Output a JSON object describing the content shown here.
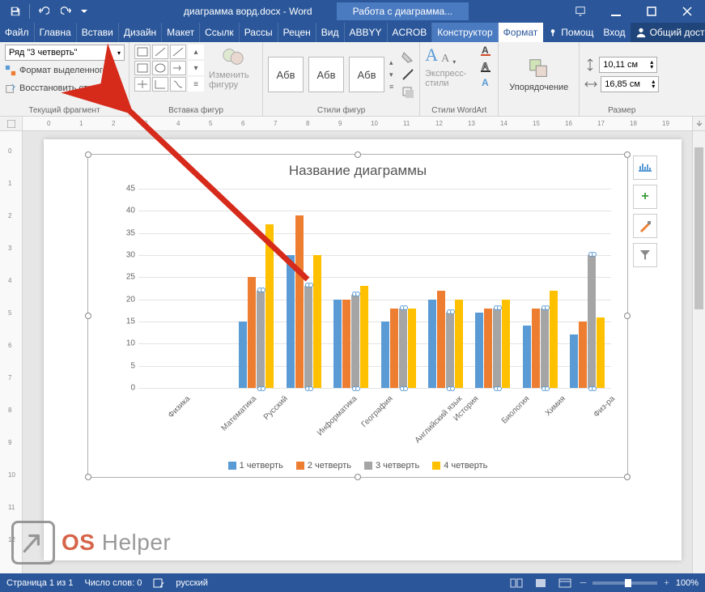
{
  "app": {
    "title_doc": "диаграмма ворд.docx - Word",
    "context_title": "Работа с диаграмма..."
  },
  "tabs": {
    "file": "Файл",
    "items": [
      "Главна",
      "Встави",
      "Дизайн",
      "Макет",
      "Ссылк",
      "Рассы",
      "Рецен",
      "Вид",
      "ABBYY",
      "ACROB"
    ],
    "context": [
      "Конструктор",
      "Формат"
    ],
    "active": "Формат",
    "help": "Помощ",
    "signin": "Вход",
    "share": "Общий доступ"
  },
  "ribbon": {
    "selection": {
      "combo": "Ряд \"3 четверть\"",
      "format_sel": "Формат выделенного",
      "reset_style": "Восстановить стиль",
      "group": "Текущий фрагмент"
    },
    "shapes": {
      "change": "Изменить фигуру",
      "group": "Вставка фигур"
    },
    "shape_styles": {
      "sample": "Абв",
      "group": "Стили фигур"
    },
    "wordart": {
      "quick": "Экспресс-стили",
      "group": "Стили WordArt"
    },
    "arrange": {
      "label": "Упорядочение"
    },
    "size": {
      "h": "10,11 см",
      "w": "16,85 см",
      "group": "Размер"
    }
  },
  "chart_data": {
    "type": "bar",
    "title": "Название диаграммы",
    "ylim": [
      0,
      45
    ],
    "ystep": 5,
    "categories": [
      "Физика",
      "Математика",
      "Русский",
      "Информатика",
      "География",
      "Английский язык",
      "История",
      "Биология",
      "Химия",
      "Физ-ра"
    ],
    "series": [
      {
        "name": "1 четверть",
        "color": "#5b9bd5",
        "values": [
          null,
          null,
          15,
          30,
          20,
          15,
          20,
          17,
          14,
          12
        ]
      },
      {
        "name": "2 четверть",
        "color": "#ed7d31",
        "values": [
          null,
          null,
          25,
          39,
          20,
          18,
          22,
          18,
          18,
          15
        ]
      },
      {
        "name": "3 четверть",
        "color": "#a5a5a5",
        "values": [
          null,
          null,
          22,
          23,
          21,
          18,
          17,
          18,
          18,
          30
        ]
      },
      {
        "name": "4 четверть",
        "color": "#ffc000",
        "values": [
          null,
          null,
          37,
          30,
          23,
          18,
          20,
          20,
          22,
          16
        ]
      }
    ],
    "selected_series": 2
  },
  "chart_buttons": [
    "layout",
    "add",
    "brush",
    "filter"
  ],
  "status": {
    "page": "Страница 1 из 1",
    "words": "Число слов: 0",
    "lang": "русский",
    "zoom": "100%"
  },
  "watermark": {
    "os": "OS",
    "helper": " Helper"
  }
}
